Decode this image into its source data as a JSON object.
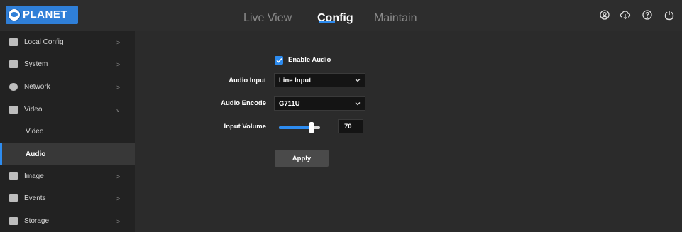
{
  "brand": {
    "name": "PLANET"
  },
  "nav": {
    "items": [
      {
        "label": "Live View",
        "active": false
      },
      {
        "label": "Config",
        "active": true
      },
      {
        "label": "Maintain",
        "active": false
      }
    ],
    "accent": "#2d8cf0"
  },
  "top_icons": [
    "user-icon",
    "cloud-download-icon",
    "help-icon",
    "power-icon"
  ],
  "sidebar": {
    "items": [
      {
        "label": "Local Config",
        "icon": "monitor-icon",
        "chevron": ">"
      },
      {
        "label": "System",
        "icon": "system-icon",
        "chevron": ">"
      },
      {
        "label": "Network",
        "icon": "network-icon",
        "chevron": ">"
      },
      {
        "label": "Video",
        "icon": "video-icon",
        "chevron": "v"
      },
      {
        "label": "Video",
        "sub": true
      },
      {
        "label": "Audio",
        "sub": true,
        "active": true
      },
      {
        "label": "Image",
        "icon": "image-icon",
        "chevron": ">"
      },
      {
        "label": "Events",
        "icon": "events-icon",
        "chevron": ">"
      },
      {
        "label": "Storage",
        "icon": "storage-icon",
        "chevron": ">"
      }
    ]
  },
  "audio": {
    "enable_label": "Enable Audio",
    "enabled": true,
    "input_label": "Audio Input",
    "input_value": "Line Input",
    "encode_label": "Audio Encode",
    "encode_value": "G711U",
    "volume_label": "Input Volume",
    "volume_value": "70",
    "volume_percent": 70,
    "apply_label": "Apply"
  }
}
